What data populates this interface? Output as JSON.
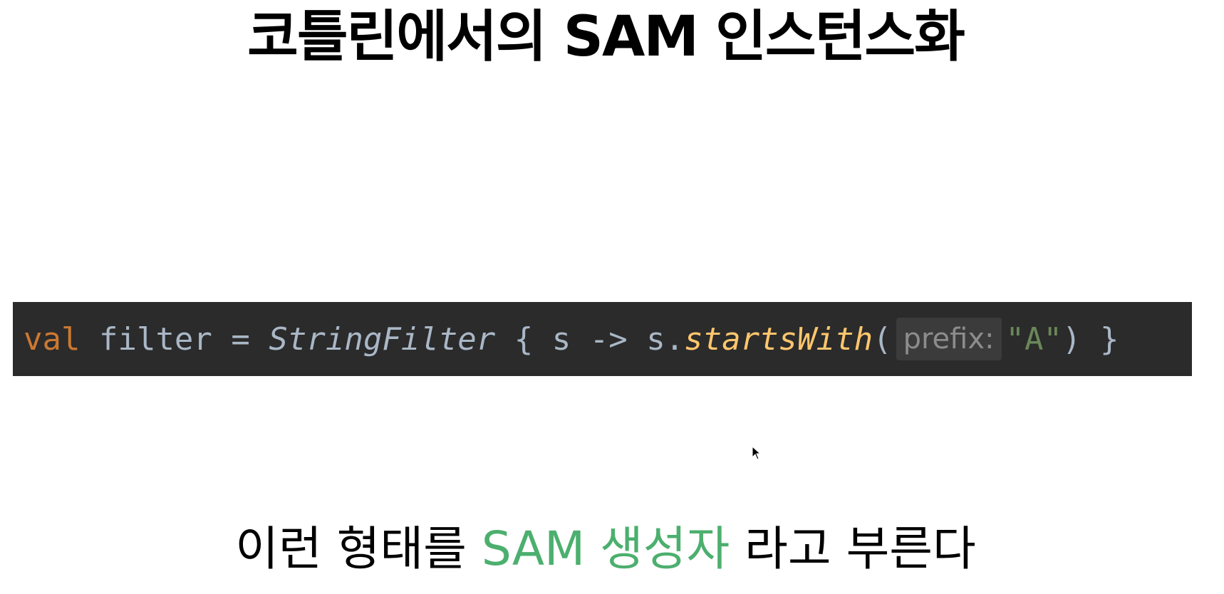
{
  "slide": {
    "title": "코틀린에서의 SAM 인스턴스화"
  },
  "code": {
    "keyword_val": "val",
    "space_1": " filter = ",
    "type_name": "StringFilter",
    "lambda_body": " { s -> s.",
    "func_name": "startsWith",
    "open_paren": "(",
    "param_hint": "prefix:",
    "string_literal": "\"A\"",
    "close": ") }"
  },
  "caption": {
    "before": "이런 형태를 ",
    "highlight": "SAM 생성자",
    "after": " 라고 부른다"
  },
  "colors": {
    "code_bg": "#2b2b2b",
    "keyword": "#cc7832",
    "function": "#ffc66d",
    "string": "#6a8759",
    "caption_highlight": "#4caf6e"
  }
}
